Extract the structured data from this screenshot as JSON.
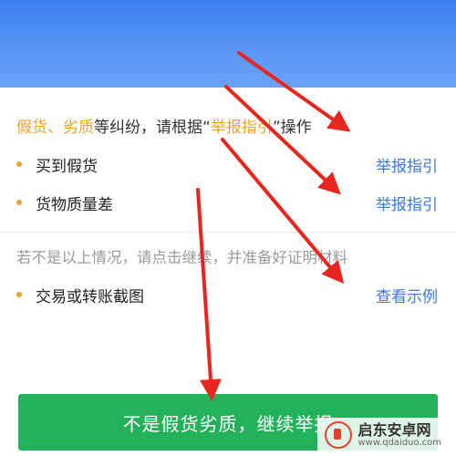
{
  "intro": {
    "part1": "假货、劣质",
    "part2": "等纠纷，请根据“",
    "part3": "举报指引",
    "part4": "”操作"
  },
  "rows": [
    {
      "label": "买到假货",
      "link": "举报指引"
    },
    {
      "label": "货物质量差",
      "link": "举报指引"
    }
  ],
  "note": "若不是以上情况，请点击继续，并准备好证明材料",
  "evidence_row": {
    "label": "交易或转账截图",
    "link": "查看示例"
  },
  "cta_label": "不是假货劣质，继续举报",
  "watermark": {
    "name": "启东安卓网",
    "url": "www.qdaiduo.com"
  },
  "colors": {
    "accent": "#f0a12c",
    "link": "#3c78d8",
    "cta": "#23b25a",
    "header": "#3c7df0",
    "arrow": "#e8251f"
  }
}
